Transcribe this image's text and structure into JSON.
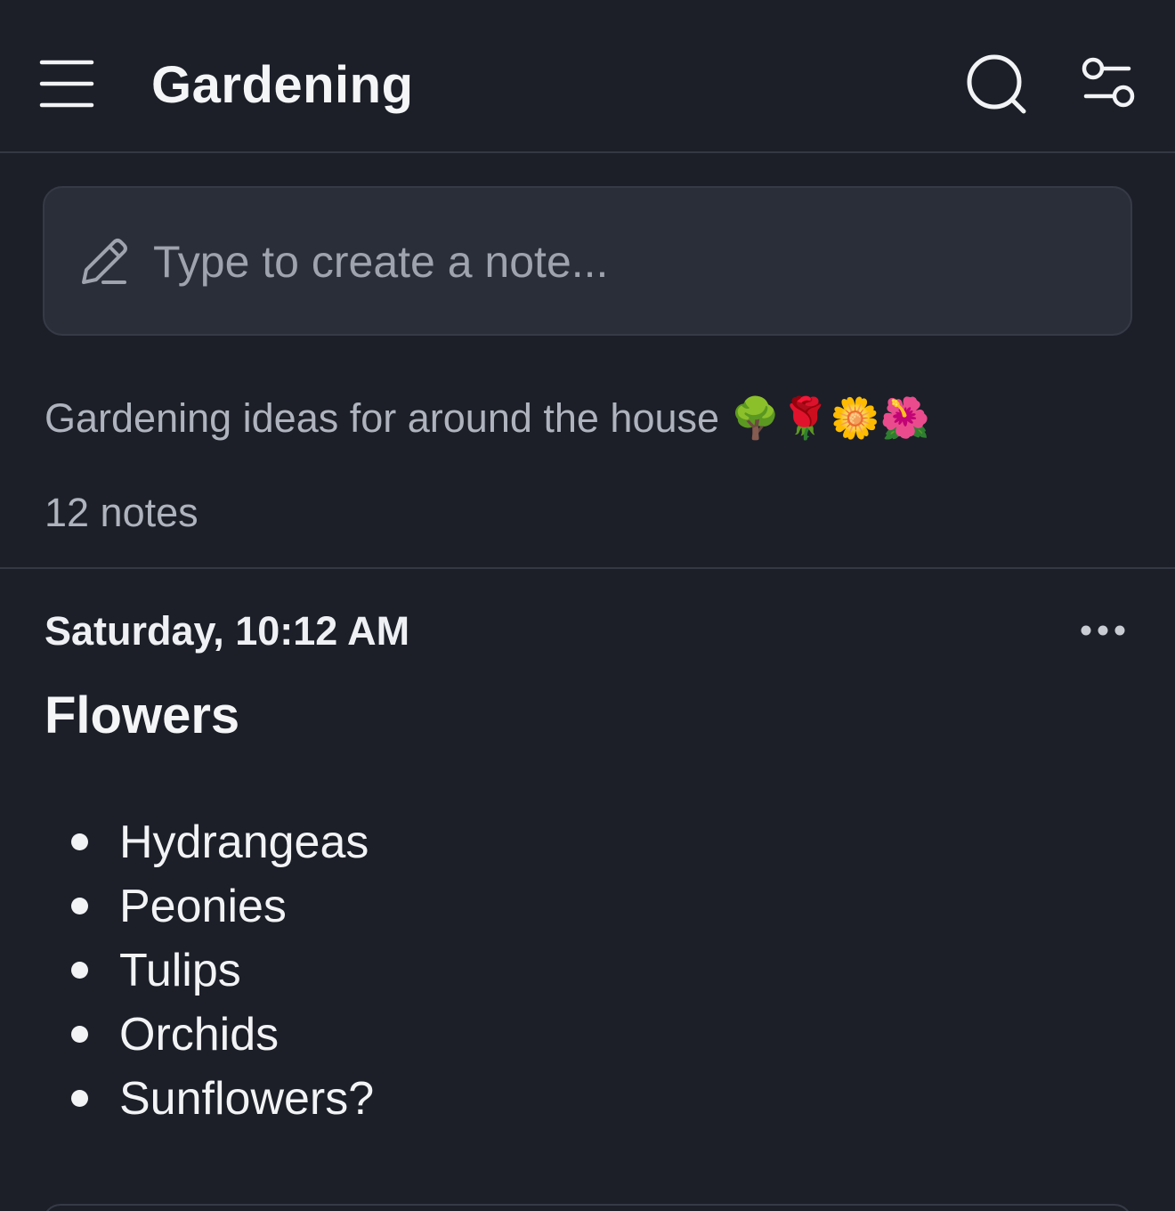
{
  "header": {
    "title": "Gardening",
    "menu_icon": "hamburger-menu-icon",
    "search_icon": "search-icon",
    "filter_icon": "filter-sliders-icon"
  },
  "composer": {
    "placeholder": "Type to create a note...",
    "icon": "pencil-icon"
  },
  "notebook": {
    "description": "Gardening ideas for around the house 🌳🌹🌼🌺",
    "note_count": "12 notes"
  },
  "notes": [
    {
      "date": "Saturday, 10:12 AM",
      "title": "Flowers",
      "items": [
        "Hydrangeas",
        "Peonies",
        "Tulips",
        "Orchids",
        "Sunflowers?"
      ],
      "more_icon": "more-horizontal-icon"
    }
  ],
  "colors": {
    "background": "#1c1f28",
    "surface": "#2a2e39",
    "border": "#343843",
    "text_primary": "#f2f3f5",
    "text_secondary": "#aeb3bd"
  }
}
